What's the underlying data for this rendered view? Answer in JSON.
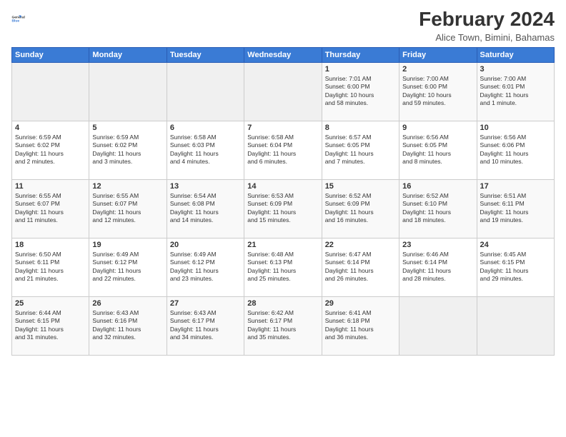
{
  "logo": {
    "line1": "General",
    "line2": "Blue"
  },
  "title": "February 2024",
  "location": "Alice Town, Bimini, Bahamas",
  "weekdays": [
    "Sunday",
    "Monday",
    "Tuesday",
    "Wednesday",
    "Thursday",
    "Friday",
    "Saturday"
  ],
  "weeks": [
    [
      {
        "day": "",
        "info": ""
      },
      {
        "day": "",
        "info": ""
      },
      {
        "day": "",
        "info": ""
      },
      {
        "day": "",
        "info": ""
      },
      {
        "day": "1",
        "info": "Sunrise: 7:01 AM\nSunset: 6:00 PM\nDaylight: 10 hours\nand 58 minutes."
      },
      {
        "day": "2",
        "info": "Sunrise: 7:00 AM\nSunset: 6:00 PM\nDaylight: 10 hours\nand 59 minutes."
      },
      {
        "day": "3",
        "info": "Sunrise: 7:00 AM\nSunset: 6:01 PM\nDaylight: 11 hours\nand 1 minute."
      }
    ],
    [
      {
        "day": "4",
        "info": "Sunrise: 6:59 AM\nSunset: 6:02 PM\nDaylight: 11 hours\nand 2 minutes."
      },
      {
        "day": "5",
        "info": "Sunrise: 6:59 AM\nSunset: 6:02 PM\nDaylight: 11 hours\nand 3 minutes."
      },
      {
        "day": "6",
        "info": "Sunrise: 6:58 AM\nSunset: 6:03 PM\nDaylight: 11 hours\nand 4 minutes."
      },
      {
        "day": "7",
        "info": "Sunrise: 6:58 AM\nSunset: 6:04 PM\nDaylight: 11 hours\nand 6 minutes."
      },
      {
        "day": "8",
        "info": "Sunrise: 6:57 AM\nSunset: 6:05 PM\nDaylight: 11 hours\nand 7 minutes."
      },
      {
        "day": "9",
        "info": "Sunrise: 6:56 AM\nSunset: 6:05 PM\nDaylight: 11 hours\nand 8 minutes."
      },
      {
        "day": "10",
        "info": "Sunrise: 6:56 AM\nSunset: 6:06 PM\nDaylight: 11 hours\nand 10 minutes."
      }
    ],
    [
      {
        "day": "11",
        "info": "Sunrise: 6:55 AM\nSunset: 6:07 PM\nDaylight: 11 hours\nand 11 minutes."
      },
      {
        "day": "12",
        "info": "Sunrise: 6:55 AM\nSunset: 6:07 PM\nDaylight: 11 hours\nand 12 minutes."
      },
      {
        "day": "13",
        "info": "Sunrise: 6:54 AM\nSunset: 6:08 PM\nDaylight: 11 hours\nand 14 minutes."
      },
      {
        "day": "14",
        "info": "Sunrise: 6:53 AM\nSunset: 6:09 PM\nDaylight: 11 hours\nand 15 minutes."
      },
      {
        "day": "15",
        "info": "Sunrise: 6:52 AM\nSunset: 6:09 PM\nDaylight: 11 hours\nand 16 minutes."
      },
      {
        "day": "16",
        "info": "Sunrise: 6:52 AM\nSunset: 6:10 PM\nDaylight: 11 hours\nand 18 minutes."
      },
      {
        "day": "17",
        "info": "Sunrise: 6:51 AM\nSunset: 6:11 PM\nDaylight: 11 hours\nand 19 minutes."
      }
    ],
    [
      {
        "day": "18",
        "info": "Sunrise: 6:50 AM\nSunset: 6:11 PM\nDaylight: 11 hours\nand 21 minutes."
      },
      {
        "day": "19",
        "info": "Sunrise: 6:49 AM\nSunset: 6:12 PM\nDaylight: 11 hours\nand 22 minutes."
      },
      {
        "day": "20",
        "info": "Sunrise: 6:49 AM\nSunset: 6:12 PM\nDaylight: 11 hours\nand 23 minutes."
      },
      {
        "day": "21",
        "info": "Sunrise: 6:48 AM\nSunset: 6:13 PM\nDaylight: 11 hours\nand 25 minutes."
      },
      {
        "day": "22",
        "info": "Sunrise: 6:47 AM\nSunset: 6:14 PM\nDaylight: 11 hours\nand 26 minutes."
      },
      {
        "day": "23",
        "info": "Sunrise: 6:46 AM\nSunset: 6:14 PM\nDaylight: 11 hours\nand 28 minutes."
      },
      {
        "day": "24",
        "info": "Sunrise: 6:45 AM\nSunset: 6:15 PM\nDaylight: 11 hours\nand 29 minutes."
      }
    ],
    [
      {
        "day": "25",
        "info": "Sunrise: 6:44 AM\nSunset: 6:15 PM\nDaylight: 11 hours\nand 31 minutes."
      },
      {
        "day": "26",
        "info": "Sunrise: 6:43 AM\nSunset: 6:16 PM\nDaylight: 11 hours\nand 32 minutes."
      },
      {
        "day": "27",
        "info": "Sunrise: 6:43 AM\nSunset: 6:17 PM\nDaylight: 11 hours\nand 34 minutes."
      },
      {
        "day": "28",
        "info": "Sunrise: 6:42 AM\nSunset: 6:17 PM\nDaylight: 11 hours\nand 35 minutes."
      },
      {
        "day": "29",
        "info": "Sunrise: 6:41 AM\nSunset: 6:18 PM\nDaylight: 11 hours\nand 36 minutes."
      },
      {
        "day": "",
        "info": ""
      },
      {
        "day": "",
        "info": ""
      }
    ]
  ]
}
